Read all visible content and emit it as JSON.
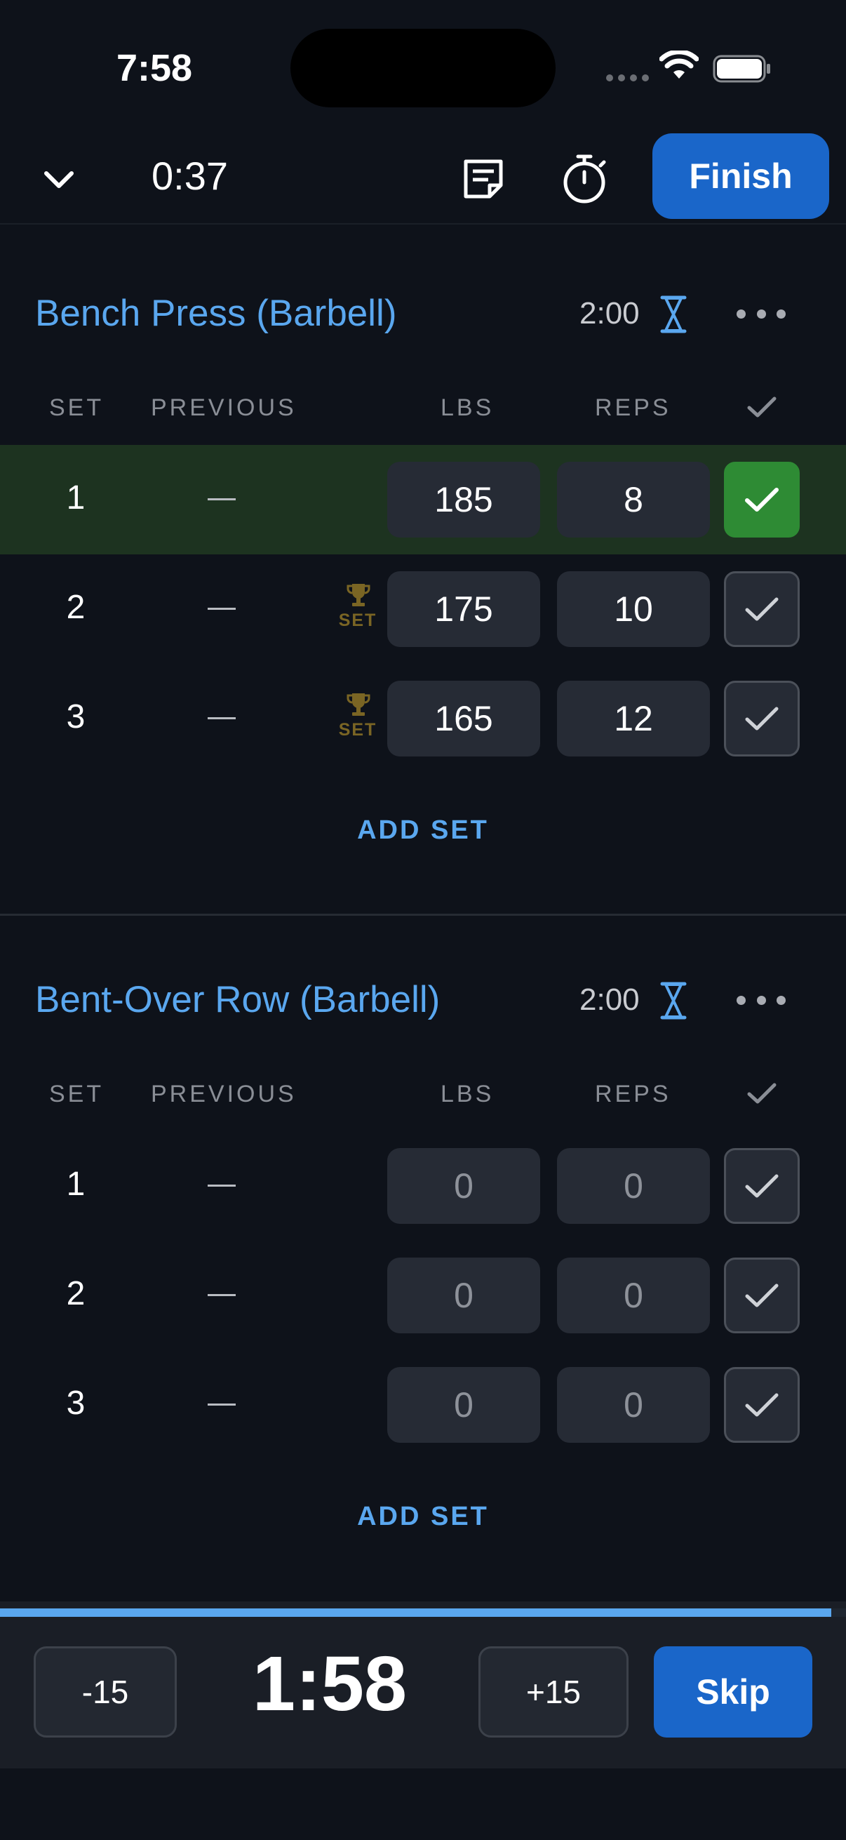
{
  "status_bar": {
    "time": "7:58"
  },
  "top_bar": {
    "elapsed": "0:37",
    "finish_label": "Finish"
  },
  "columns": {
    "set": "SET",
    "previous": "PREVIOUS",
    "lbs": "LBS",
    "reps": "REPS"
  },
  "exercises": [
    {
      "name": "Bench Press (Barbell)",
      "rest_timer": "2:00",
      "add_set_label": "ADD SET",
      "sets": [
        {
          "set": "1",
          "previous": "—",
          "lbs": "185",
          "reps": "8",
          "completed": true,
          "pr_badge": ""
        },
        {
          "set": "2",
          "previous": "—",
          "lbs": "175",
          "reps": "10",
          "completed": false,
          "pr_badge": "SET"
        },
        {
          "set": "3",
          "previous": "—",
          "lbs": "165",
          "reps": "12",
          "completed": false,
          "pr_badge": "SET"
        }
      ]
    },
    {
      "name": "Bent-Over Row (Barbell)",
      "rest_timer": "2:00",
      "add_set_label": "ADD SET",
      "sets": [
        {
          "set": "1",
          "previous": "—",
          "lbs": "0",
          "reps": "0",
          "completed": false,
          "pr_badge": ""
        },
        {
          "set": "2",
          "previous": "—",
          "lbs": "0",
          "reps": "0",
          "completed": false,
          "pr_badge": ""
        },
        {
          "set": "3",
          "previous": "—",
          "lbs": "0",
          "reps": "0",
          "completed": false,
          "pr_badge": ""
        }
      ]
    }
  ],
  "rest_timer": {
    "minus_label": "-15",
    "time": "1:58",
    "plus_label": "+15",
    "skip_label": "Skip",
    "progress": 0.983
  },
  "colors": {
    "accent": "#5aa7ef",
    "primary_button": "#1a66c9",
    "completed_row": "#1d3320",
    "completed_check": "#2e8b34",
    "pr_gold": "#7a6524"
  },
  "icons": {
    "collapse": "chevron-down-icon",
    "notes": "notes-icon",
    "stopwatch": "stopwatch-icon",
    "hourglass": "hourglass-icon",
    "more": "more-icon",
    "check": "check-icon",
    "trophy": "trophy-icon"
  }
}
